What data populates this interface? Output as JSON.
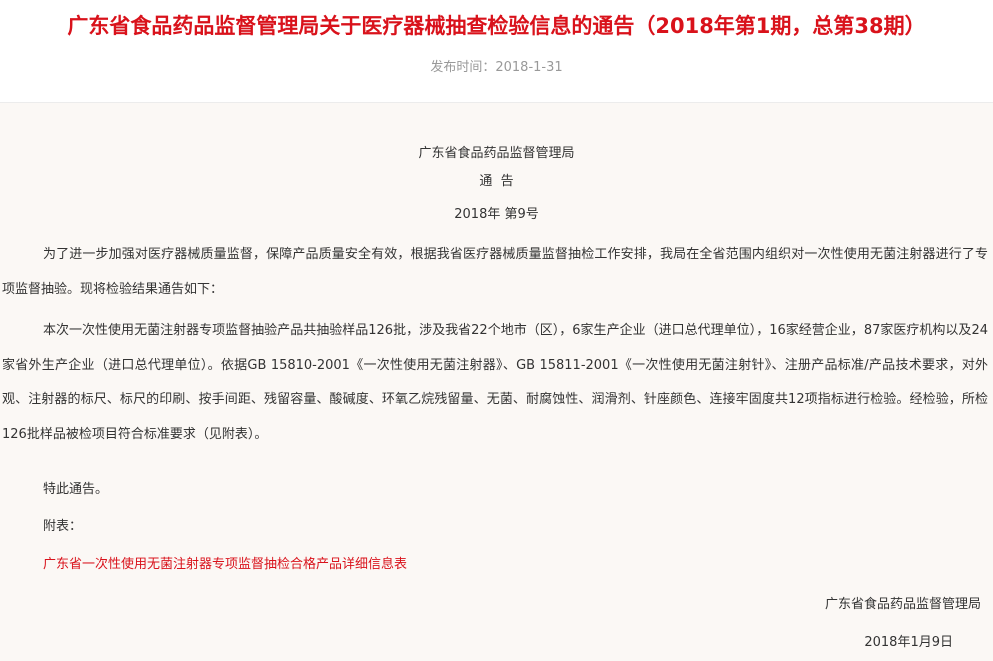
{
  "header": {
    "title": "广东省食品药品监督管理局关于医疗器械抽查检验信息的通告（2018年第1期，总第38期）",
    "publish_label": "发布时间：2018-1-31"
  },
  "notice": {
    "issuer": "广东省食品药品监督管理局",
    "heading": "通  告",
    "number": "2018年 第9号",
    "paragraph_1": "为了进一步加强对医疗器械质量监督，保障产品质量安全有效，根据我省医疗器械质量监督抽检工作安排，我局在全省范围内组织对一次性使用无菌注射器进行了专项监督抽验。现将检验结果通告如下：",
    "paragraph_2": "本次一次性使用无菌注射器专项监督抽验产品共抽验样品126批，涉及我省22个地市（区），6家生产企业（进口总代理单位），16家经营企业，87家医疗机构以及24家省外生产企业（进口总代理单位）。依据GB 15810-2001《一次性使用无菌注射器》、GB 15811-2001《一次性使用无菌注射针》、注册产品标准/产品技术要求，对外观、注射器的标尺、标尺的印刷、按手间距、残留容量、酸碱度、环氧乙烷残留量、无菌、耐腐蚀性、润滑剂、针座颜色、连接牢固度共12项指标进行检验。经检验，所检126批样品被检项目符合标准要求（见附表）。",
    "special_notice": "特此通告。",
    "attachment_label": "附表：",
    "attachment_link": "广东省一次性使用无菌注射器专项监督抽检合格产品详细信息表",
    "signature": "广东省食品药品监督管理局",
    "date": "2018年1月9日"
  },
  "colors": {
    "title_red": "#d9121b",
    "link_red": "#d9121b",
    "content_bg": "#fbf8f5",
    "meta_gray": "#999999"
  }
}
